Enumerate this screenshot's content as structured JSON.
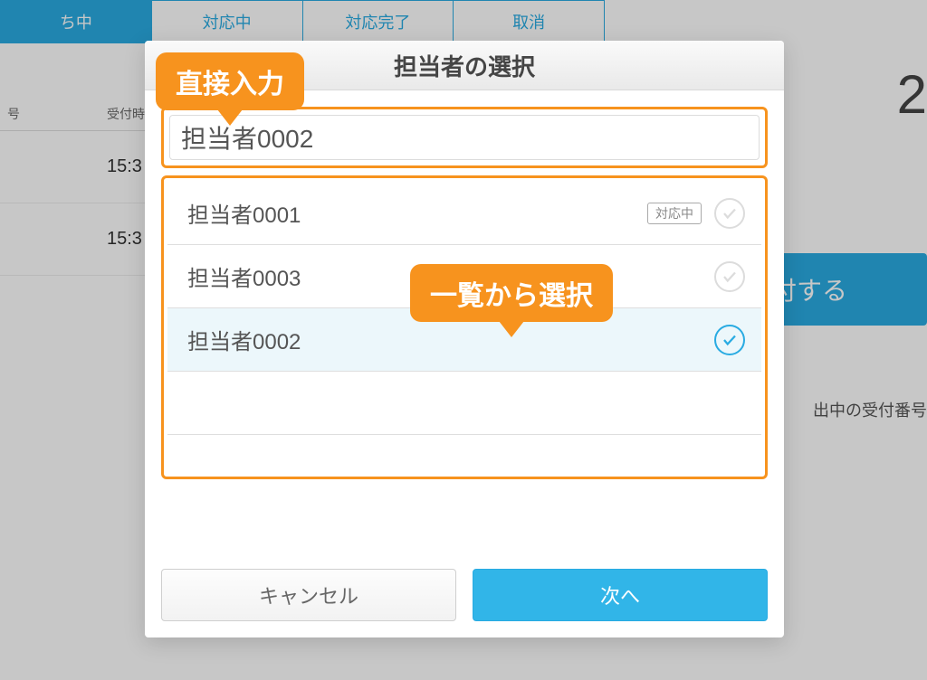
{
  "tabs": {
    "t0": "ち中",
    "t1": "対応中",
    "t2": "対応完了",
    "t3": "取消"
  },
  "table": {
    "head_col1": "号",
    "head_col2": "受付時",
    "row1_time": "15:3",
    "row2_time": "15:3"
  },
  "side": {
    "big_number_fragment": "2",
    "primary_button_fragment": "付する",
    "caption_fragment": "出中の受付番号"
  },
  "modal": {
    "title": "担当者の選択",
    "input_value": "担当者0002",
    "list": {
      "r0": {
        "name": "担当者0001",
        "badge": "対応中",
        "selected": false,
        "has_badge": true
      },
      "r1": {
        "name": "担当者0003",
        "badge": "",
        "selected": false,
        "has_badge": false
      },
      "r2": {
        "name": "担当者0002",
        "badge": "",
        "selected": true,
        "has_badge": false
      }
    },
    "cancel": "キャンセル",
    "next": "次へ"
  },
  "callouts": {
    "direct": "直接入力",
    "list": "一覧から選択"
  }
}
